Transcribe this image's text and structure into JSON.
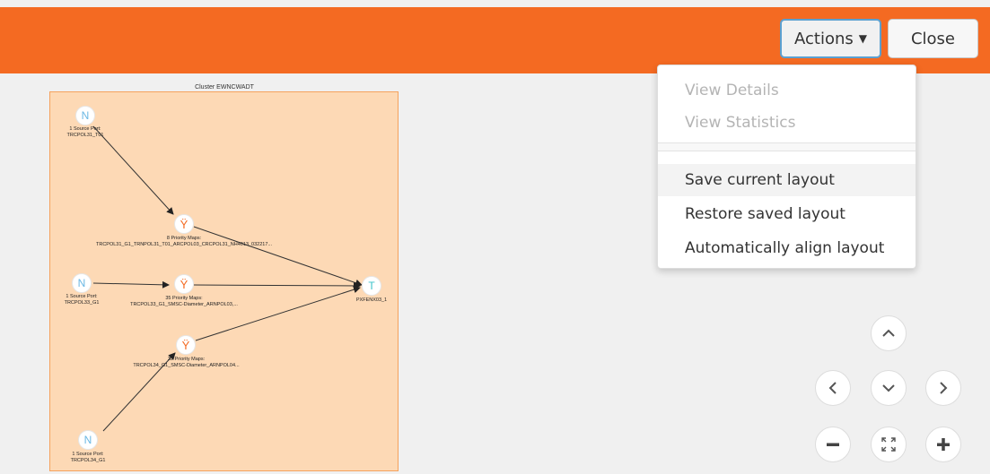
{
  "header": {
    "actions_label": "Actions",
    "close_label": "Close",
    "brand_color": "#f46a22"
  },
  "actions_menu": {
    "items": [
      {
        "label": "View Details",
        "enabled": false
      },
      {
        "label": "View Statistics",
        "enabled": false
      },
      {
        "label": "Save current layout",
        "enabled": true,
        "highlighted": true
      },
      {
        "label": "Restore saved layout",
        "enabled": true
      },
      {
        "label": "Automatically align layout",
        "enabled": true
      }
    ]
  },
  "graph": {
    "cluster_title": "Cluster EWNCWADT",
    "nodes": {
      "source1": {
        "icon": "N",
        "label": [
          "1 Source Port:",
          "TRCPOL31_T01"
        ]
      },
      "map1": {
        "icon": "map-icon",
        "label": [
          "8 Priority Maps:",
          "TRCPOL31_G1_TRNPOL31_T01_ARCPOL03_CRCPOL31_NH4013_032217..."
        ]
      },
      "source2": {
        "icon": "N",
        "label": [
          "1 Source Port:",
          "TRCPOL33_G1"
        ]
      },
      "map2": {
        "icon": "map-icon",
        "label": [
          "35 Priority Maps:",
          "TRCPOL33_G1_SMSC-Diameter_ARNPOL03,..."
        ]
      },
      "target": {
        "icon": "T",
        "label": [
          "PXFENX03_1"
        ]
      },
      "map3": {
        "icon": "map-icon",
        "label": [
          "32 Priority Maps:",
          "TRCPOL34_G1_SMSC-Diameter_ARNPOL04..."
        ]
      },
      "source3": {
        "icon": "N",
        "label": [
          "1 Source Port:",
          "TRCPOL34_G1"
        ]
      }
    }
  },
  "navigation": {
    "buttons": [
      "pan-up",
      "pan-left",
      "pan-down",
      "pan-right",
      "zoom-out",
      "fit-to-screen",
      "zoom-in"
    ]
  }
}
